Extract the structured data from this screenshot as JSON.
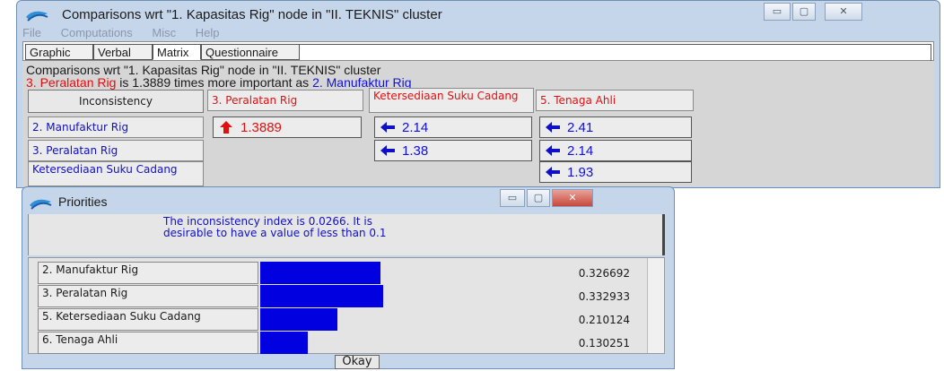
{
  "main_window": {
    "title": "Comparisons wrt \"1. Kapasitas Rig\" node in \"II. TEKNIS\" cluster",
    "menu": [
      "File",
      "Computations",
      "Misc",
      "Help"
    ],
    "tabs": [
      {
        "label": "Graphic",
        "active": false
      },
      {
        "label": "Verbal",
        "active": false
      },
      {
        "label": "Matrix",
        "active": true
      },
      {
        "label": "Questionnaire",
        "active": false
      }
    ],
    "info_line1": "Comparisons wrt \"1. Kapasitas Rig\" node in \"II. TEKNIS\" cluster",
    "info_line2": {
      "part1": "3. Peralatan Rig",
      "part2": " is 1.3889 times more important as ",
      "part3": "2. Manufaktur Rig"
    },
    "inconsistency_button": "Inconsistency",
    "col_headers": [
      "3. Peralatan Rig",
      "Ketersediaan Suku Cadang",
      "5. Tenaga Ahli"
    ],
    "row_headers": [
      "2. Manufaktur Rig",
      "3. Peralatan Rig",
      "Ketersediaan Suku Cadang"
    ],
    "cells": [
      {
        "value": "1.3889",
        "arrow": "up",
        "color": "#e01010"
      },
      {
        "value": "2.14",
        "arrow": "left",
        "color": "#1010e0"
      },
      {
        "value": "2.41",
        "arrow": "left",
        "color": "#1010e0"
      },
      {
        "value": "1.38",
        "arrow": "left",
        "color": "#1010e0"
      },
      {
        "value": "2.14",
        "arrow": "left",
        "color": "#1010e0"
      },
      {
        "value": "1.93",
        "arrow": "left",
        "color": "#1010e0"
      }
    ]
  },
  "priorities_window": {
    "title": "Priorities",
    "message": "The inconsistency index is 0.0266. It is desirable to have a value of less than 0.1",
    "items": [
      {
        "label": "2. Manufaktur Rig",
        "value": "0.326692",
        "priority": 0.326692
      },
      {
        "label": "3. Peralatan Rig",
        "value": "0.332933",
        "priority": 0.332933
      },
      {
        "label": "5. Ketersediaan Suku Cadang",
        "value": "0.210124",
        "priority": 0.210124
      },
      {
        "label": "6. Tenaga Ahli",
        "value": "0.130251",
        "priority": 0.130251
      }
    ],
    "okay_button": "Okay"
  }
}
